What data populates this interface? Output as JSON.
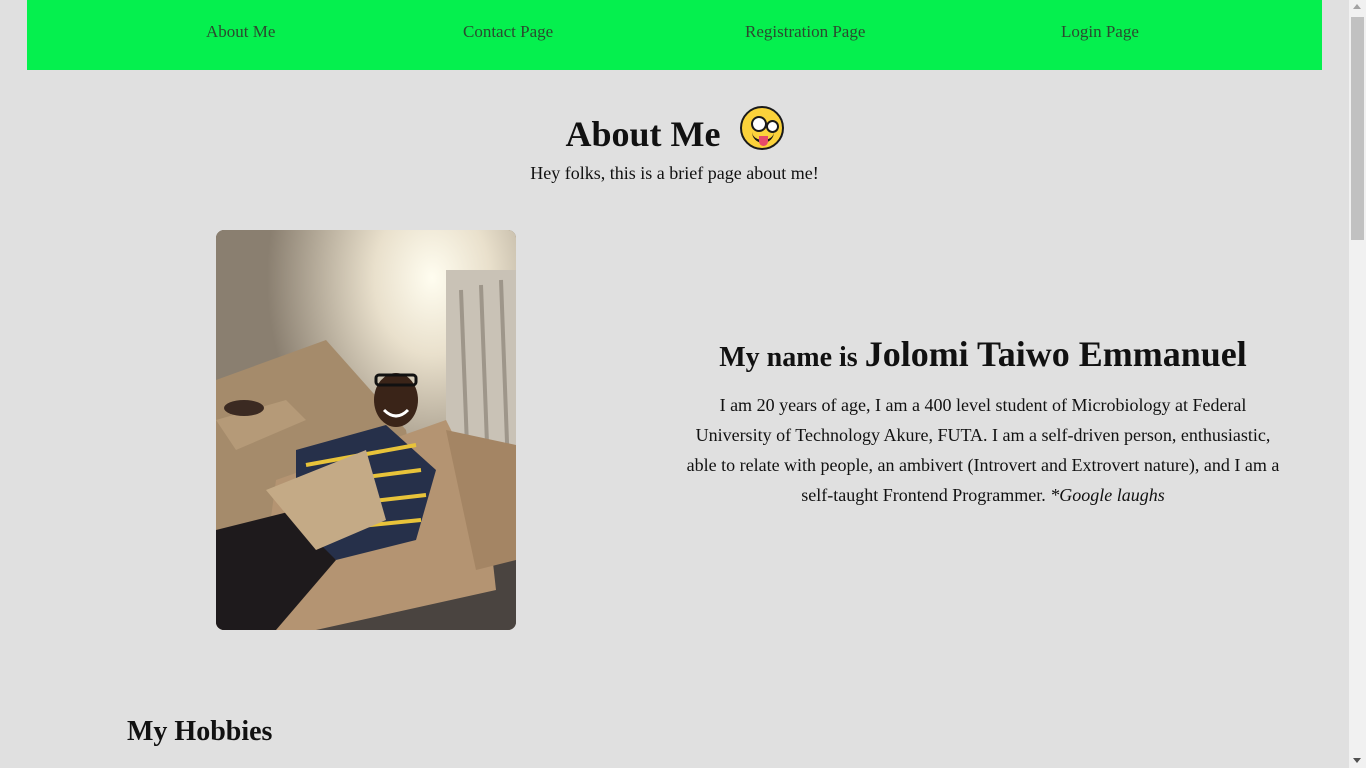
{
  "nav": {
    "items": [
      {
        "label": "About Me"
      },
      {
        "label": "Contact Page"
      },
      {
        "label": "Registration Page"
      },
      {
        "label": "Login Page"
      }
    ],
    "background_color": "#05f04e"
  },
  "hero": {
    "title": "About Me",
    "emoji": "zany-face-icon",
    "subtitle": "Hey folks, this is a brief page about me!"
  },
  "profile": {
    "photo": "profile-photo",
    "heading_prefix": "My name is",
    "name": "Jolomi Taiwo Emmanuel",
    "bio": "I am 20 years of age, I am a 400 level student of Microbiology at Federal University of Technology Akure, FUTA. I am a self-driven person, enthusiastic, able to relate with people, an ambivert (Introvert and Extrovert nature), and I am a self-taught Frontend Programmer.",
    "bio_aside": "*Google laughs"
  },
  "hobbies": {
    "title": "My Hobbies"
  },
  "colors": {
    "page_background": "#e0e0e0",
    "nav_background": "#05f04e",
    "nav_text": "#2b4a2f"
  }
}
